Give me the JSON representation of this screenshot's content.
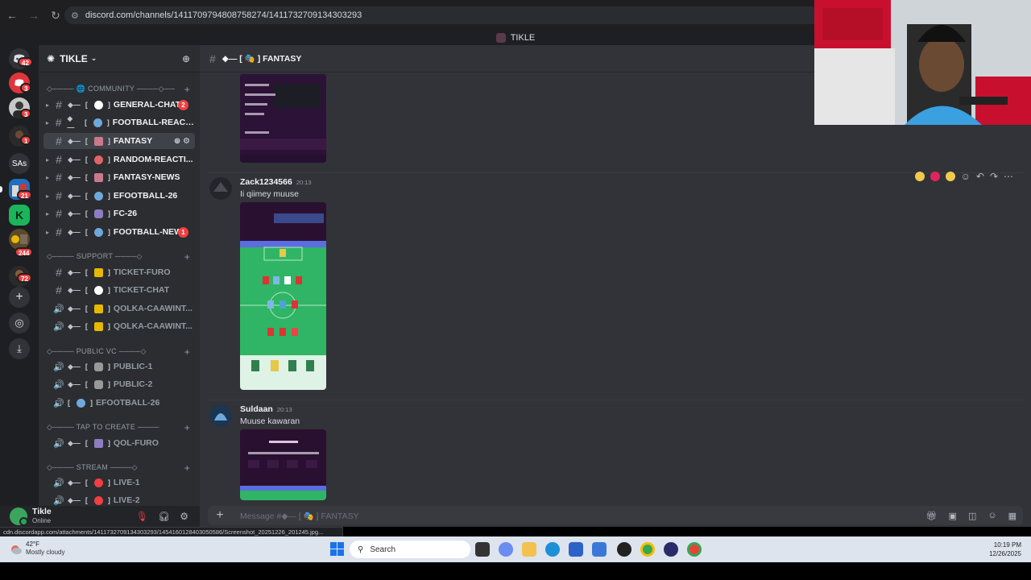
{
  "browser": {
    "url": "discord.com/channels/1411709794808758274/1411732709134303293",
    "window_title": "TIKLE",
    "status_url": "cdn.discordapp.com/attachments/1411732709134303293/1454160128403050586/Screenshot_20251226_201245.jpg..."
  },
  "servers": {
    "home_badge": "42",
    "items": [
      {
        "label": "",
        "badge": "3"
      },
      {
        "label": "",
        "badge": "3"
      },
      {
        "label": "",
        "badge": "1"
      },
      {
        "label": "SAs",
        "badge": ""
      },
      {
        "label": "",
        "badge": "21"
      },
      {
        "label": "K",
        "badge": ""
      },
      {
        "label": "",
        "badge": "244"
      },
      {
        "label": "",
        "badge": "72"
      }
    ]
  },
  "guild": {
    "name": "TIKLE"
  },
  "categories": {
    "community": "◇──── 🌐 COMMUNITY ────◇──",
    "support": "◇──── SUPPORT ────◇",
    "public_vc": "◇──── PUBLIC VC ────◇",
    "tap_to_create": "◇──── TAP TO CREATE ────",
    "stream": "◇──── STREAM ────◇"
  },
  "channels": {
    "general_chat": {
      "name": "GENERAL-CHAT",
      "badge": "2"
    },
    "football_react": {
      "name": "FOOTBALL-REACT..."
    },
    "fantasy": {
      "name": "FANTASY"
    },
    "random_reacti": {
      "name": "RANDOM-REACTI..."
    },
    "fantasy_news": {
      "name": "FANTASY-NEWS"
    },
    "efootball_26": {
      "name": "EFOOTBALL-26"
    },
    "fc_26": {
      "name": "FC-26"
    },
    "football_news": {
      "name": "FOOTBALL-NEWS",
      "badge": "1"
    },
    "ticket_furo": {
      "name": "TICKET-FURO"
    },
    "ticket_chat": {
      "name": "TICKET-CHAT"
    },
    "qolka_1": {
      "name": "QOLKA-CAAWINT..."
    },
    "qolka_2": {
      "name": "QOLKA-CAAWINT..."
    },
    "public_1": {
      "name": "PUBLIC-1"
    },
    "public_2": {
      "name": "PUBLIC-2"
    },
    "efootball_vc": {
      "name": "EFOOTBALL-26"
    },
    "qol_furo": {
      "name": "QOL-FURO"
    },
    "live_1": {
      "name": "LIVE-1"
    },
    "live_2": {
      "name": "LIVE-2"
    }
  },
  "user": {
    "name": "Tikle",
    "status": "Online"
  },
  "header": {
    "channel": "◆— [ 🎭 ] FANTASY"
  },
  "messages": [
    {
      "author": "Zack1234566",
      "time": "20:13",
      "text": "Ii qiimey muuse"
    },
    {
      "author": "Suldaan",
      "time": "20:13",
      "text": "Muuse kawaran"
    }
  ],
  "composer": {
    "placeholder": "Message #◆— [ 🎭 ] FANTASY"
  },
  "taskbar": {
    "temp": "42°F",
    "condition": "Mostly cloudy",
    "search": "Search",
    "time": "10:19 PM",
    "date": "12/26/2025"
  },
  "colors": {
    "blurple": "#5865f2",
    "danger": "#f23f42",
    "online": "#23a55a"
  }
}
